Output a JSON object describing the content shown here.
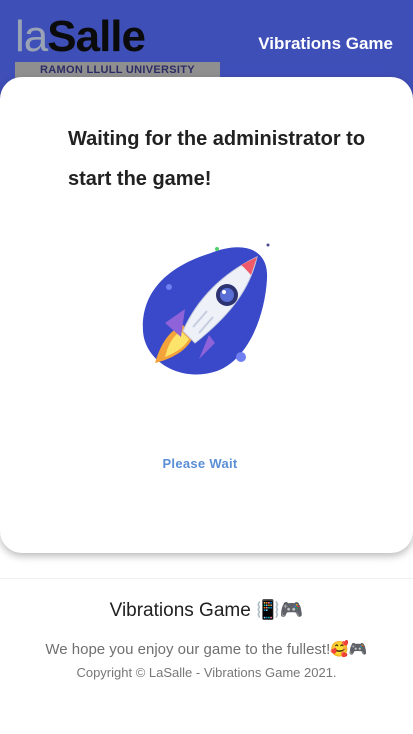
{
  "header": {
    "logo_text_part1": "la",
    "logo_text_part2": "Salle",
    "logo_subtitle": "RAMON LLULL UNIVERSITY",
    "app_title": "Vibrations Game",
    "background_color": "#3f4fb8"
  },
  "main": {
    "waiting_message": "Waiting for the administrator to start the game!",
    "illustration_icon": "rocket-icon",
    "status_text": "Please Wait"
  },
  "footer": {
    "title": "Vibrations Game 📳🎮",
    "message": "We hope you enjoy our game to the fullest!🥰🎮",
    "copyright": "Copyright © LaSalle - Vibrations Game 2021."
  }
}
